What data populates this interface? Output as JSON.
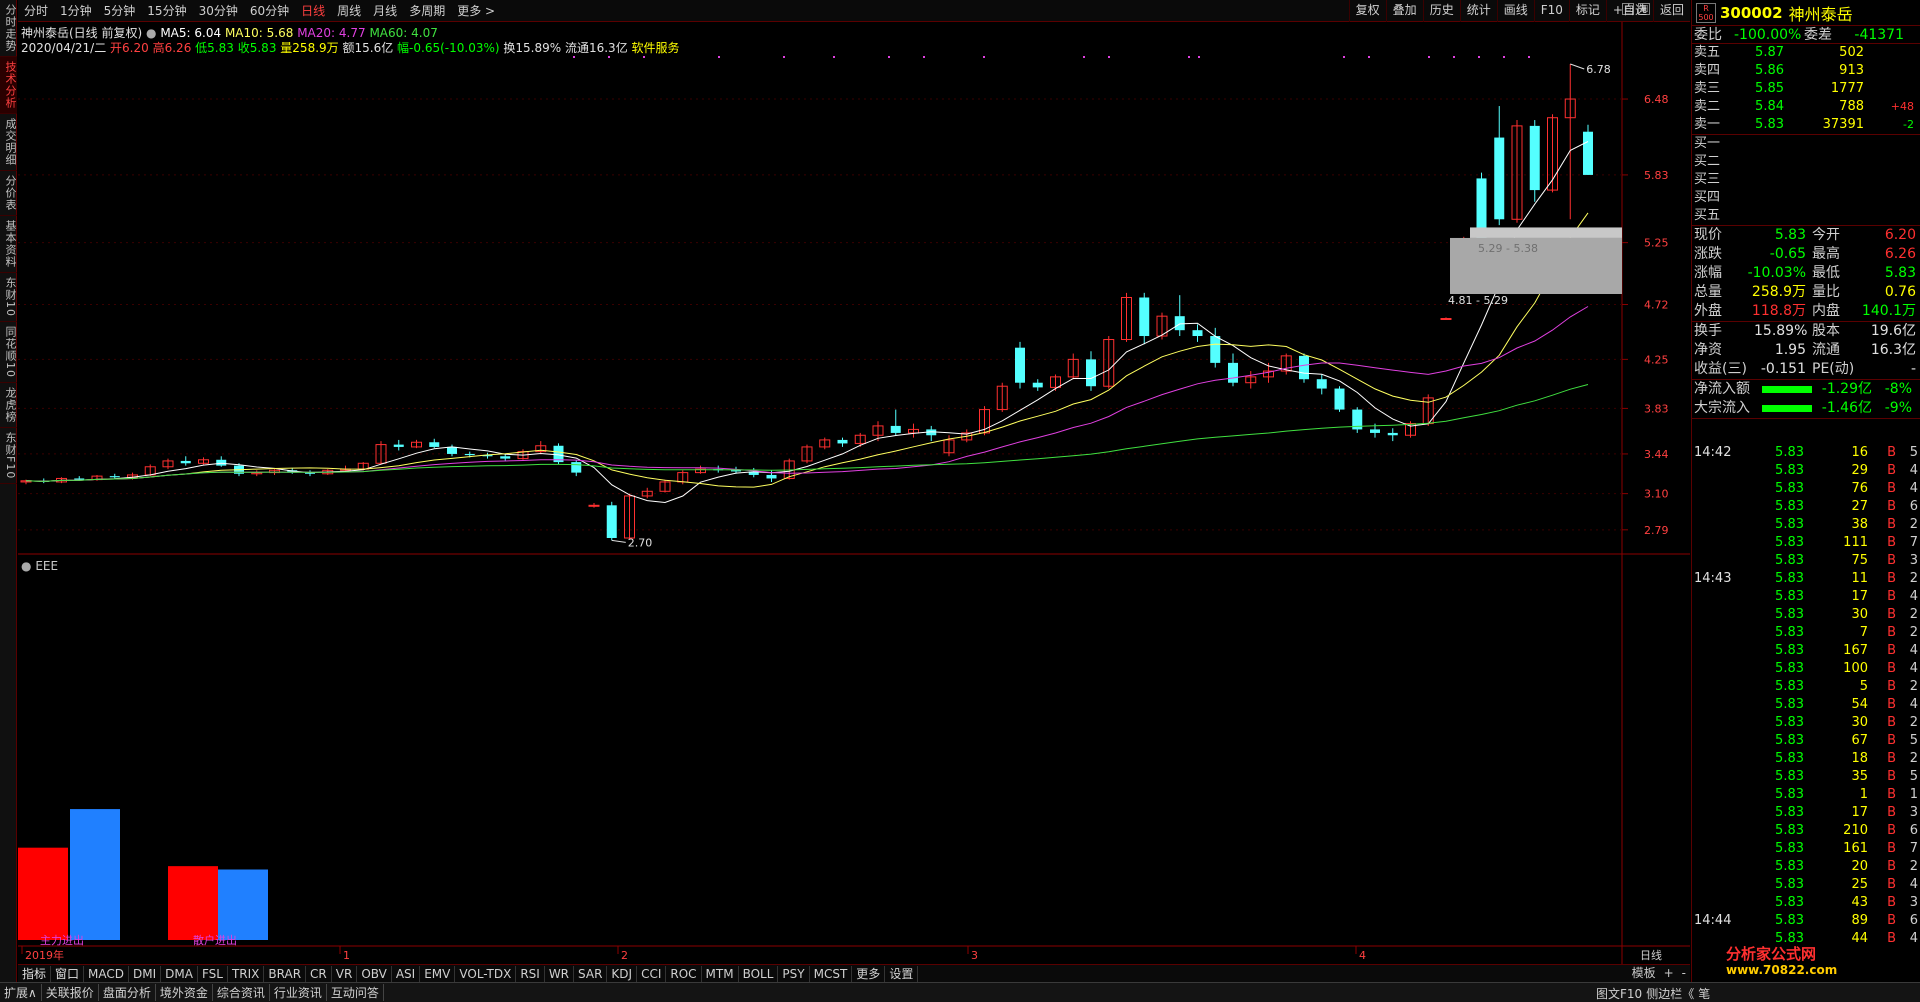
{
  "left_tabs": [
    "分时走势",
    "技术分析",
    "成交明细",
    "分价表",
    "基本资料",
    "东财10",
    "同花顺10",
    "龙虎榜",
    "东财F10"
  ],
  "left_tabs_active": 1,
  "period_tabs": [
    "分时",
    "1分钟",
    "5分钟",
    "15分钟",
    "30分钟",
    "60分钟",
    "日线",
    "周线",
    "月线",
    "多周期",
    "更多 >"
  ],
  "period_active": 6,
  "top_tools": [
    "复权",
    "叠加",
    "历史",
    "统计",
    "画线",
    "F10",
    "标记",
    "+自选",
    "返回"
  ],
  "header": {
    "title": "神州泰岳(日线 前复权)",
    "ma5": "MA5: 6.04",
    "ma10": "MA10: 5.68",
    "ma20": "MA20: 4.77",
    "ma60": "MA60: 4.07",
    "date": "2020/04/21/二",
    "open": "开6.20",
    "high": "高6.26",
    "low": "低5.83",
    "close": "收5.83",
    "vol": "量258.9万",
    "amt": "额15.6亿",
    "chg": "幅-0.65(-10.03%)",
    "turnover": "换15.89%",
    "float": "流通16.3亿",
    "industry": "软件服务"
  },
  "price_axis": [
    "6.48",
    "5.83",
    "5.25",
    "4.72",
    "4.25",
    "3.83",
    "3.44",
    "3.10",
    "2.79"
  ],
  "annotations": {
    "high": "6.78",
    "low": "2.70",
    "gap1": "5.29 - 5.38",
    "gap2": "4.81 - 5.29"
  },
  "sub_label": "EEE",
  "sub_bars": {
    "label1": "主力进出",
    "label2": "散户进出"
  },
  "time_axis": [
    "2019年",
    "1",
    "2",
    "3",
    "4"
  ],
  "indicator_tabs": [
    "指标",
    "窗口",
    "MACD",
    "DMI",
    "DMA",
    "FSL",
    "TRIX",
    "BRAR",
    "CR",
    "VR",
    "OBV",
    "ASI",
    "EMV",
    "VOL-TDX",
    "RSI",
    "WR",
    "SAR",
    "KDJ",
    "CCI",
    "ROC",
    "MTM",
    "BOLL",
    "PSY",
    "MCST",
    "更多",
    "设置"
  ],
  "indicator_right": [
    "模板",
    "+",
    "-"
  ],
  "period_label": "日线",
  "status_tabs": [
    "扩展∧",
    "关联报价",
    "盘面分析",
    "境外资金",
    "综合资讯",
    "行业资讯",
    "互动问答"
  ],
  "status_right": [
    "图文F10",
    "侧边栏《",
    "笔"
  ],
  "stock": {
    "badge": "R 500",
    "code": "300002",
    "name": "神州泰岳"
  },
  "weibi": {
    "k1": "委比",
    "v1": "-100.00%",
    "k2": "委差",
    "v2": "-41371"
  },
  "sell_book": [
    {
      "label": "卖五",
      "price": "5.87",
      "vol": "502",
      "chg": ""
    },
    {
      "label": "卖四",
      "price": "5.86",
      "vol": "913",
      "chg": ""
    },
    {
      "label": "卖三",
      "price": "5.85",
      "vol": "1777",
      "chg": ""
    },
    {
      "label": "卖二",
      "price": "5.84",
      "vol": "788",
      "chg": "+48"
    },
    {
      "label": "卖一",
      "price": "5.83",
      "vol": "37391",
      "chg": "-2"
    }
  ],
  "buy_book": [
    {
      "label": "买一"
    },
    {
      "label": "买二"
    },
    {
      "label": "买三"
    },
    {
      "label": "买四"
    },
    {
      "label": "买五"
    }
  ],
  "quote": [
    {
      "k1": "现价",
      "v1": "5.83",
      "c1": "green",
      "k2": "今开",
      "v2": "6.20",
      "c2": "red"
    },
    {
      "k1": "涨跌",
      "v1": "-0.65",
      "c1": "green",
      "k2": "最高",
      "v2": "6.26",
      "c2": "red"
    },
    {
      "k1": "涨幅",
      "v1": "-10.03%",
      "c1": "green",
      "k2": "最低",
      "v2": "5.83",
      "c2": "green"
    },
    {
      "k1": "总量",
      "v1": "258.9万",
      "c1": "yellow",
      "k2": "量比",
      "v2": "0.76",
      "c2": "yellow"
    },
    {
      "k1": "外盘",
      "v1": "118.8万",
      "c1": "red",
      "k2": "内盘",
      "v2": "140.1万",
      "c2": "green"
    }
  ],
  "quote2": [
    {
      "k1": "换手",
      "v1": "15.89%",
      "c1": "white",
      "k2": "股本",
      "v2": "19.6亿",
      "c2": "white"
    },
    {
      "k1": "净资",
      "v1": "1.95",
      "c1": "white",
      "k2": "流通",
      "v2": "16.3亿",
      "c2": "white"
    },
    {
      "k1": "收益(三)",
      "v1": "-0.151",
      "c1": "white",
      "k2": "PE(动)",
      "v2": "-",
      "c2": "white"
    }
  ],
  "flows": [
    {
      "label": "净流入额",
      "value": "-1.29亿",
      "pct": "-8%"
    },
    {
      "label": "大宗流入",
      "value": "-1.46亿",
      "pct": "-9%"
    }
  ],
  "trades": [
    {
      "time": "14:42",
      "price": "5.83",
      "vol": "16",
      "dir": "B",
      "cnt": "5"
    },
    {
      "time": "",
      "price": "5.83",
      "vol": "29",
      "dir": "B",
      "cnt": "4"
    },
    {
      "time": "",
      "price": "5.83",
      "vol": "76",
      "dir": "B",
      "cnt": "4"
    },
    {
      "time": "",
      "price": "5.83",
      "vol": "27",
      "dir": "B",
      "cnt": "6"
    },
    {
      "time": "",
      "price": "5.83",
      "vol": "38",
      "dir": "B",
      "cnt": "2"
    },
    {
      "time": "",
      "price": "5.83",
      "vol": "111",
      "dir": "B",
      "cnt": "7"
    },
    {
      "time": "",
      "price": "5.83",
      "vol": "75",
      "dir": "B",
      "cnt": "3"
    },
    {
      "time": "14:43",
      "price": "5.83",
      "vol": "11",
      "dir": "B",
      "cnt": "2"
    },
    {
      "time": "",
      "price": "5.83",
      "vol": "17",
      "dir": "B",
      "cnt": "4"
    },
    {
      "time": "",
      "price": "5.83",
      "vol": "30",
      "dir": "B",
      "cnt": "2"
    },
    {
      "time": "",
      "price": "5.83",
      "vol": "7",
      "dir": "B",
      "cnt": "2"
    },
    {
      "time": "",
      "price": "5.83",
      "vol": "167",
      "dir": "B",
      "cnt": "4"
    },
    {
      "time": "",
      "price": "5.83",
      "vol": "100",
      "dir": "B",
      "cnt": "4"
    },
    {
      "time": "",
      "price": "5.83",
      "vol": "5",
      "dir": "B",
      "cnt": "2"
    },
    {
      "time": "",
      "price": "5.83",
      "vol": "54",
      "dir": "B",
      "cnt": "4"
    },
    {
      "time": "",
      "price": "5.83",
      "vol": "30",
      "dir": "B",
      "cnt": "2"
    },
    {
      "time": "",
      "price": "5.83",
      "vol": "67",
      "dir": "B",
      "cnt": "5"
    },
    {
      "time": "",
      "price": "5.83",
      "vol": "18",
      "dir": "B",
      "cnt": "2"
    },
    {
      "time": "",
      "price": "5.83",
      "vol": "35",
      "dir": "B",
      "cnt": "5"
    },
    {
      "time": "",
      "price": "5.83",
      "vol": "1",
      "dir": "B",
      "cnt": "1"
    },
    {
      "time": "",
      "price": "5.83",
      "vol": "17",
      "dir": "B",
      "cnt": "3"
    },
    {
      "time": "",
      "price": "5.83",
      "vol": "210",
      "dir": "B",
      "cnt": "6"
    },
    {
      "time": "",
      "price": "5.83",
      "vol": "161",
      "dir": "B",
      "cnt": "7"
    },
    {
      "time": "",
      "price": "5.83",
      "vol": "20",
      "dir": "B",
      "cnt": "2"
    },
    {
      "time": "",
      "price": "5.83",
      "vol": "25",
      "dir": "B",
      "cnt": "4"
    },
    {
      "time": "",
      "price": "5.83",
      "vol": "43",
      "dir": "B",
      "cnt": "3"
    },
    {
      "time": "14:44",
      "price": "5.83",
      "vol": "89",
      "dir": "B",
      "cnt": "6"
    },
    {
      "time": "",
      "price": "5.83",
      "vol": "44",
      "dir": "B",
      "cnt": "4"
    }
  ],
  "watermark": {
    "text": "分析家公式网",
    "url": "www.70822.com"
  },
  "chart_data": {
    "type": "candlestick",
    "ylim": [
      2.6,
      6.9
    ],
    "candles": [
      [
        3.2,
        3.22,
        3.18,
        3.21
      ],
      [
        3.21,
        3.23,
        3.19,
        3.2
      ],
      [
        3.2,
        3.24,
        3.19,
        3.23
      ],
      [
        3.23,
        3.25,
        3.21,
        3.22
      ],
      [
        3.22,
        3.26,
        3.21,
        3.25
      ],
      [
        3.25,
        3.27,
        3.23,
        3.24
      ],
      [
        3.24,
        3.28,
        3.22,
        3.26
      ],
      [
        3.26,
        3.35,
        3.25,
        3.33
      ],
      [
        3.33,
        3.4,
        3.31,
        3.38
      ],
      [
        3.38,
        3.42,
        3.34,
        3.36
      ],
      [
        3.36,
        3.41,
        3.35,
        3.39
      ],
      [
        3.39,
        3.42,
        3.33,
        3.34
      ],
      [
        3.34,
        3.36,
        3.25,
        3.27
      ],
      [
        3.27,
        3.3,
        3.25,
        3.28
      ],
      [
        3.28,
        3.31,
        3.26,
        3.3
      ],
      [
        3.3,
        3.32,
        3.27,
        3.28
      ],
      [
        3.28,
        3.3,
        3.25,
        3.27
      ],
      [
        3.27,
        3.31,
        3.26,
        3.3
      ],
      [
        3.3,
        3.34,
        3.29,
        3.31
      ],
      [
        3.31,
        3.37,
        3.3,
        3.36
      ],
      [
        3.36,
        3.55,
        3.35,
        3.52
      ],
      [
        3.52,
        3.56,
        3.47,
        3.5
      ],
      [
        3.5,
        3.56,
        3.49,
        3.54
      ],
      [
        3.54,
        3.57,
        3.49,
        3.5
      ],
      [
        3.5,
        3.52,
        3.42,
        3.44
      ],
      [
        3.44,
        3.46,
        3.41,
        3.43
      ],
      [
        3.43,
        3.45,
        3.4,
        3.42
      ],
      [
        3.42,
        3.44,
        3.38,
        3.4
      ],
      [
        3.4,
        3.48,
        3.39,
        3.46
      ],
      [
        3.46,
        3.55,
        3.44,
        3.51
      ],
      [
        3.51,
        3.53,
        3.35,
        3.37
      ],
      [
        3.37,
        3.39,
        3.25,
        3.28
      ],
      [
        3.0,
        3.02,
        2.98,
        3.0
      ],
      [
        3.0,
        3.03,
        2.7,
        2.72
      ],
      [
        2.72,
        3.1,
        2.71,
        3.08
      ],
      [
        3.08,
        3.15,
        3.06,
        3.12
      ],
      [
        3.12,
        3.22,
        3.11,
        3.2
      ],
      [
        3.2,
        3.3,
        3.18,
        3.28
      ],
      [
        3.28,
        3.34,
        3.27,
        3.31
      ],
      [
        3.31,
        3.34,
        3.28,
        3.3
      ],
      [
        3.3,
        3.33,
        3.27,
        3.29
      ],
      [
        3.29,
        3.32,
        3.24,
        3.26
      ],
      [
        3.26,
        3.3,
        3.2,
        3.23
      ],
      [
        3.23,
        3.4,
        3.22,
        3.38
      ],
      [
        3.38,
        3.52,
        3.36,
        3.5
      ],
      [
        3.5,
        3.58,
        3.48,
        3.56
      ],
      [
        3.56,
        3.58,
        3.5,
        3.53
      ],
      [
        3.53,
        3.62,
        3.5,
        3.6
      ],
      [
        3.6,
        3.72,
        3.55,
        3.68
      ],
      [
        3.68,
        3.82,
        3.6,
        3.62
      ],
      [
        3.62,
        3.7,
        3.58,
        3.65
      ],
      [
        3.65,
        3.68,
        3.55,
        3.6
      ],
      [
        3.45,
        3.6,
        3.42,
        3.56
      ],
      [
        3.56,
        3.65,
        3.54,
        3.62
      ],
      [
        3.62,
        3.85,
        3.6,
        3.82
      ],
      [
        3.82,
        4.05,
        3.8,
        4.02
      ],
      [
        4.35,
        4.4,
        4.0,
        4.05
      ],
      [
        4.05,
        4.08,
        3.98,
        4.01
      ],
      [
        4.01,
        4.12,
        3.98,
        4.1
      ],
      [
        4.1,
        4.3,
        4.08,
        4.25
      ],
      [
        4.25,
        4.32,
        3.98,
        4.02
      ],
      [
        4.02,
        4.45,
        4.0,
        4.42
      ],
      [
        4.42,
        4.82,
        4.4,
        4.78
      ],
      [
        4.78,
        4.82,
        4.38,
        4.45
      ],
      [
        4.45,
        4.65,
        4.42,
        4.62
      ],
      [
        4.62,
        4.8,
        4.45,
        4.5
      ],
      [
        4.5,
        4.55,
        4.4,
        4.45
      ],
      [
        4.45,
        4.52,
        4.18,
        4.22
      ],
      [
        4.22,
        4.3,
        4.02,
        4.05
      ],
      [
        4.05,
        4.15,
        4.0,
        4.1
      ],
      [
        4.1,
        4.22,
        4.05,
        4.15
      ],
      [
        4.15,
        4.3,
        4.12,
        4.28
      ],
      [
        4.28,
        4.3,
        4.05,
        4.08
      ],
      [
        4.08,
        4.12,
        3.95,
        4.0
      ],
      [
        4.0,
        4.02,
        3.8,
        3.82
      ],
      [
        3.82,
        3.84,
        3.62,
        3.65
      ],
      [
        3.65,
        3.7,
        3.58,
        3.62
      ],
      [
        3.62,
        3.66,
        3.55,
        3.6
      ],
      [
        3.6,
        3.72,
        3.58,
        3.7
      ],
      [
        3.7,
        3.95,
        3.68,
        3.92
      ],
      [
        4.6,
        4.61,
        4.59,
        4.6
      ],
      [
        5.25,
        5.3,
        5.22,
        5.28
      ],
      [
        5.8,
        5.85,
        5.2,
        5.22
      ],
      [
        6.15,
        6.42,
        5.4,
        5.45
      ],
      [
        5.45,
        6.3,
        5.42,
        6.25
      ],
      [
        6.25,
        6.3,
        5.6,
        5.7
      ],
      [
        5.7,
        6.35,
        5.68,
        6.32
      ],
      [
        6.32,
        6.78,
        5.45,
        6.48
      ],
      [
        6.2,
        6.26,
        5.83,
        5.83
      ]
    ],
    "ma_series": [
      "MA5",
      "MA10",
      "MA20",
      "MA60"
    ],
    "sub_bars_data": [
      {
        "name": "主力进出",
        "values": [
          0.55,
          0.78
        ]
      },
      {
        "name": "散户进出",
        "values": [
          0.44,
          0.42
        ]
      }
    ]
  }
}
